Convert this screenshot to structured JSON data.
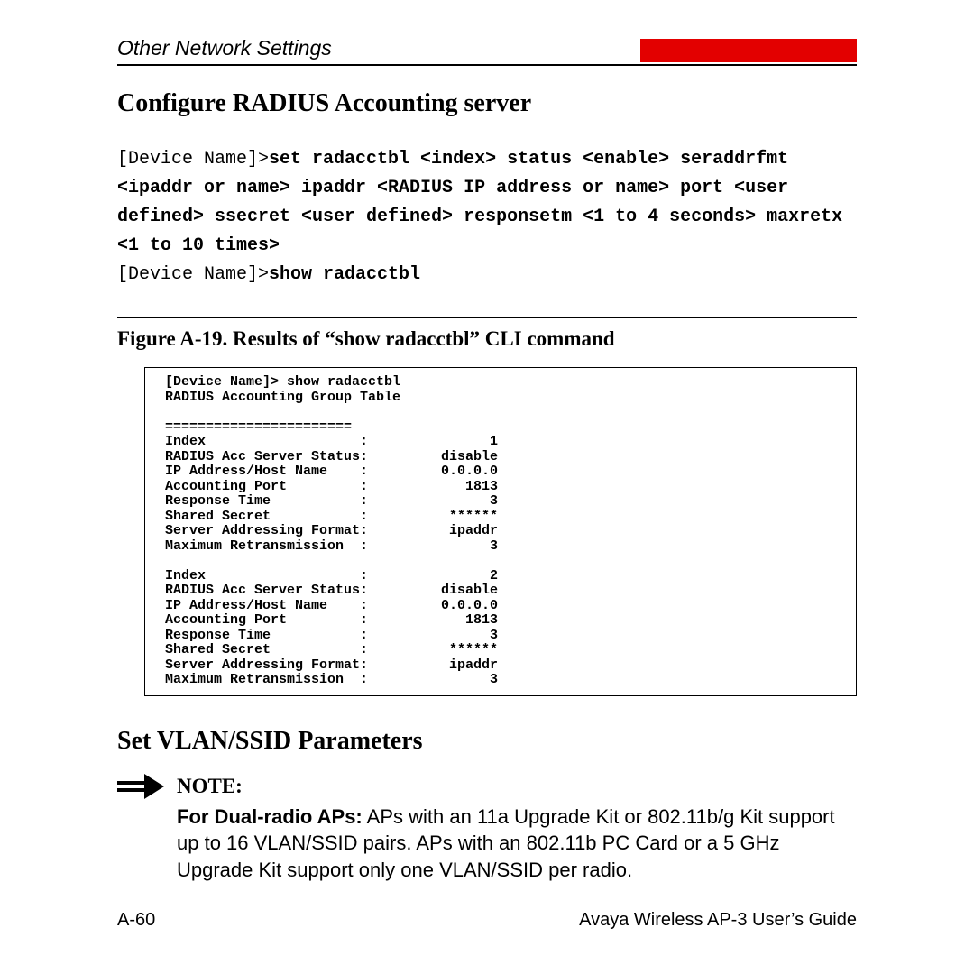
{
  "header": {
    "section_title": "Other Network Settings"
  },
  "heading1": "Configure RADIUS Accounting server",
  "cmd": {
    "prompt1": "[Device Name]>",
    "set_cmd": "set radacctbl <index> status <enable> seraddrfmt <ipaddr or name> ipaddr <RADIUS IP address or name> port <user defined> ssecret <user defined> responsetm <1 to 4 seconds> maxretx <1 to 10 times>",
    "prompt2": "[Device Name]>",
    "show_cmd": "show radacctbl"
  },
  "figure": {
    "caption": "Figure A-19.   Results of “show radacctbl” CLI command",
    "prompt_line": "[Device Name]> show radacctbl",
    "table_title": "RADIUS Accounting Group Table",
    "divider": "=======================",
    "entries": [
      {
        "Index": "1",
        "RADIUS Acc Server Status": "disable",
        "IP Address/Host Name": "0.0.0.0",
        "Accounting Port": "1813",
        "Response Time": "3",
        "Shared Secret": "******",
        "Server Addressing Format": "ipaddr",
        "Maximum Retransmission": "3"
      },
      {
        "Index": "2",
        "RADIUS Acc Server Status": "disable",
        "IP Address/Host Name": "0.0.0.0",
        "Accounting Port": "1813",
        "Response Time": "3",
        "Shared Secret": "******",
        "Server Addressing Format": "ipaddr",
        "Maximum Retransmission": "3"
      }
    ]
  },
  "heading2": "Set VLAN/SSID Parameters",
  "note": {
    "label": "NOTE:",
    "lead_in": "For Dual-radio APs:",
    "body": " APs with an 11a Upgrade Kit or 802.11b/g Kit support up to 16 VLAN/SSID pairs. APs with an 802.11b PC Card or a 5 GHz Upgrade Kit support only one VLAN/SSID per radio."
  },
  "footer": {
    "page": "A-60",
    "doc": "Avaya Wireless AP-3 User’s Guide"
  }
}
